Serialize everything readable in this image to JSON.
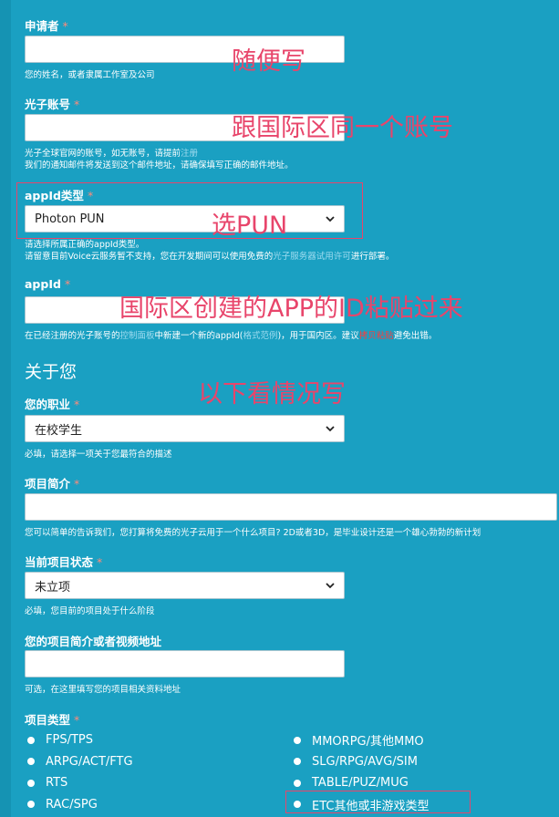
{
  "applicant": {
    "label": "申请者",
    "req": "*",
    "hint": "您的姓名，或者隶属工作室及公司",
    "value": ""
  },
  "account": {
    "label": "光子账号",
    "req": "*",
    "hint1_pre": "光子全球官网的账号，如无账号，请提前",
    "hint1_link": "注册",
    "hint2": "我们的通知邮件将发送到这个邮件地址，请确保填写正确的邮件地址。",
    "value": ""
  },
  "appid_type": {
    "label": "appId类型",
    "req": "*",
    "selected": "Photon PUN",
    "hint1": "请选择所属正确的appId类型。",
    "hint2_pre": "请留意目前Voice云服务暂不支持，您在开发期间可以使用免费的",
    "hint2_link": "光子服务器试用许可",
    "hint2_post": "进行部署。"
  },
  "appid": {
    "label": "appId",
    "req": "*",
    "value": "",
    "hint_pre": "在已经注册的光子账号的",
    "hint_link1": "控制面板",
    "hint_mid": "中新建一个新的appId(",
    "hint_link2": "格式范例",
    "hint_mid2": ")，用于国内区。建议",
    "hint_red": "拷贝粘贴",
    "hint_post": "避免出错。"
  },
  "about": {
    "title": "关于您"
  },
  "job": {
    "label": "您的职业",
    "req": "*",
    "selected": "在校学生",
    "hint": "必填，请选择一项关于您最符合的描述"
  },
  "project_intro": {
    "label": "项目简介",
    "req": "*",
    "value": "",
    "hint": "您可以简单的告诉我们，您打算将免费的光子云用于一个什么项目? 2D或者3D，是毕业设计还是一个雄心勃勃的新计划"
  },
  "project_status": {
    "label": "当前项目状态",
    "req": "*",
    "selected": "未立项",
    "hint": "必填，您目前的项目处于什么阶段"
  },
  "project_url": {
    "label": "您的项目简介或者视频地址",
    "value": "",
    "hint": "可选，在这里填写您的项目相关资料地址"
  },
  "project_type": {
    "label": "项目类型",
    "req": "*",
    "options_left": [
      "FPS/TPS",
      "ARPG/ACT/FTG",
      "RTS",
      "RAC/SPG"
    ],
    "options_right": [
      "MMORPG/其他MMO",
      "SLG/RPG/AVG/SIM",
      "TABLE/PUZ/MUG",
      "ETC其他或非游戏类型"
    ]
  },
  "annotations": {
    "a1": "随便写",
    "a2": "跟国际区同一个账号",
    "a3": "选PUN",
    "a4": "国际区创建的APP的ID粘贴过来",
    "a5": "以下看情况写"
  },
  "colors": {
    "background": "#1aa0c2",
    "annotation": "#e8456b"
  }
}
